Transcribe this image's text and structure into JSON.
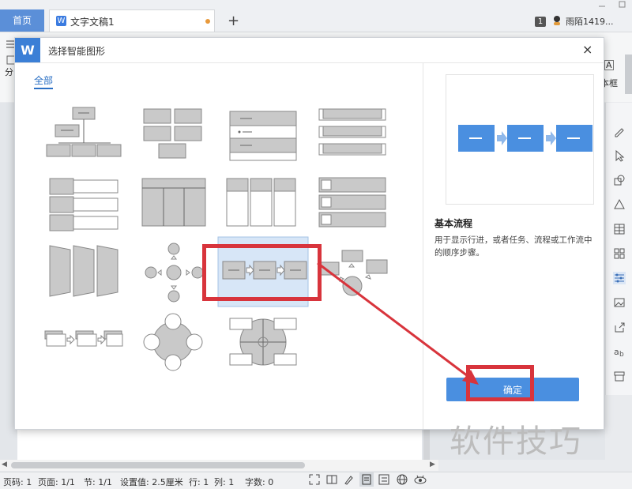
{
  "tabs": {
    "home_label": "首页",
    "doc_label": "文字文稿1",
    "new_tab_symbol": "+",
    "badge": "1",
    "user_name": "雨陌1419..."
  },
  "toolbar": {
    "left_fragment": "分",
    "right_fragment": "本框",
    "right_icon_text": "A"
  },
  "dialog": {
    "title": "选择智能图形",
    "close_symbol": "×",
    "category_all": "全部",
    "preview": {
      "name": "基本流程",
      "description": "用于显示行进，或者任务、流程或工作流中的顺序步骤。",
      "colors": {
        "box": "#4a8fe0",
        "arrow": "#8fb8ea"
      }
    },
    "confirm_label": "确定",
    "selected_template": "basic-process"
  },
  "statusbar": {
    "page_code": "页码: 1",
    "page": "页面: 1/1",
    "section": "节: 1/1",
    "setting": "设置值: 2.5厘米",
    "row": "行: 1",
    "col": "列: 1",
    "word_count": "字数: 0"
  },
  "watermark": "软件技巧",
  "accent_colors": {
    "primary": "#4a8fe0",
    "annotation": "#d8343c"
  }
}
